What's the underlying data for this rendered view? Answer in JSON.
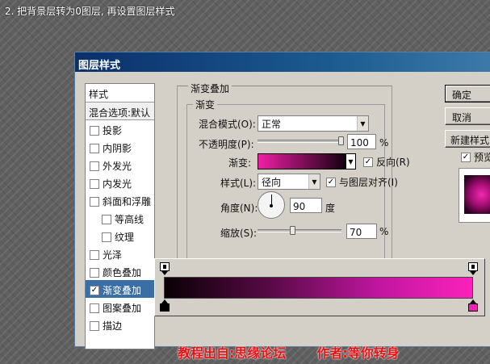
{
  "caption": "2. 把背景层转为0图层, 再设置图层样式",
  "dialog": {
    "title": "图层样式",
    "styles_header": "样式",
    "blend_options": "混合选项:默认",
    "style_items": [
      {
        "label": "投影",
        "checked": false,
        "sub": false
      },
      {
        "label": "内阴影",
        "checked": false,
        "sub": false
      },
      {
        "label": "外发光",
        "checked": false,
        "sub": false
      },
      {
        "label": "内发光",
        "checked": false,
        "sub": false
      },
      {
        "label": "斜面和浮雕",
        "checked": false,
        "sub": false
      },
      {
        "label": "等高线",
        "checked": false,
        "sub": true
      },
      {
        "label": "纹理",
        "checked": false,
        "sub": true
      },
      {
        "label": "光泽",
        "checked": false,
        "sub": false
      },
      {
        "label": "颜色叠加",
        "checked": false,
        "sub": false
      },
      {
        "label": "渐变叠加",
        "checked": true,
        "sub": false,
        "selected": true
      },
      {
        "label": "图案叠加",
        "checked": false,
        "sub": false
      },
      {
        "label": "描边",
        "checked": false,
        "sub": false
      }
    ],
    "group_title": "渐变叠加",
    "subgroup_title": "渐变",
    "blend_mode": {
      "label": "混合模式(O):",
      "value": "正常"
    },
    "opacity": {
      "label": "不透明度(P):",
      "value": "100",
      "unit": "%",
      "level_percent": 100
    },
    "gradient": {
      "label": "渐变:",
      "reverse_label": "反向(R)",
      "reverse_checked": true
    },
    "style": {
      "label": "样式(L):",
      "value": "径向",
      "align_label": "与图层对齐(I)",
      "align_checked": true
    },
    "angle": {
      "label": "角度(N):",
      "value": "90",
      "unit": "度"
    },
    "scale": {
      "label": "缩放(S):",
      "value": "70",
      "unit": "%",
      "level_percent": 70
    },
    "buttons": {
      "ok": "确定",
      "cancel": "取消",
      "new_style": "新建样式(W)...",
      "preview_label": "预览(V)",
      "preview_checked": true
    }
  },
  "credits": {
    "source": "教程出自:思缘论坛",
    "author": "作者:等你转身"
  },
  "colors": {
    "accent_pink": "#f021b0",
    "credits_red": "#e51313",
    "title_blue": "#0b2f6b"
  }
}
